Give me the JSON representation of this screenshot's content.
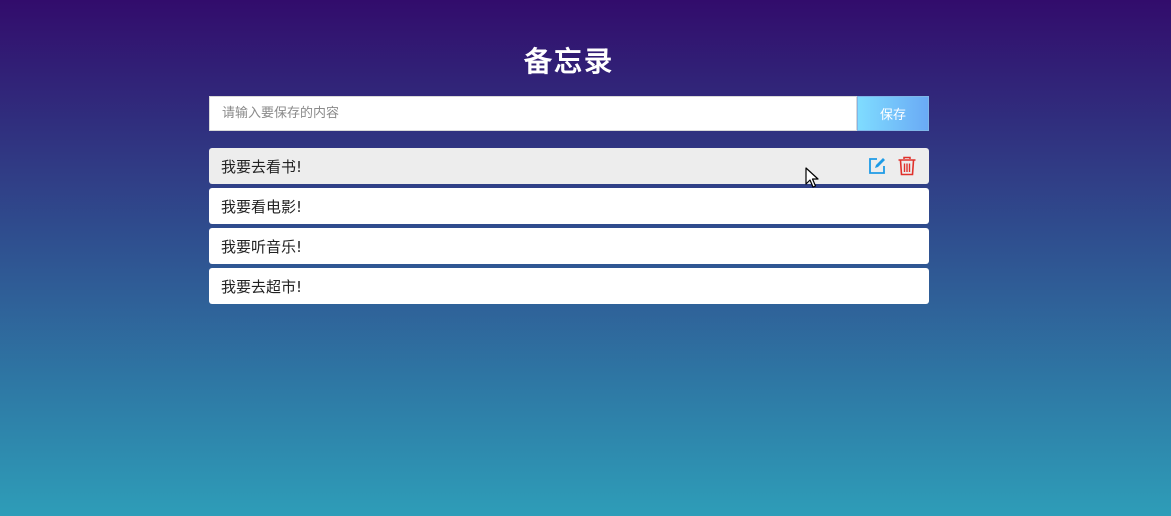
{
  "header": {
    "title": "备忘录"
  },
  "composer": {
    "placeholder": "请输入要保存的内容",
    "value": "",
    "save_label": "保存"
  },
  "memos": [
    {
      "text": "我要去看书!",
      "hovered": true
    },
    {
      "text": "我要看电影!",
      "hovered": false
    },
    {
      "text": "我要听音乐!",
      "hovered": false
    },
    {
      "text": "我要去超市!",
      "hovered": false
    }
  ],
  "item_actions": {
    "edit_icon": "edit-icon",
    "delete_icon": "trash-icon",
    "edit_color": "#1e9be6",
    "delete_color": "#e0312b"
  },
  "colors": {
    "background_top": "#320c6c",
    "background_bottom": "#2e9db8",
    "save_button_start": "#7fdcff",
    "save_button_end": "#6aaaf5",
    "hover_row": "#ededed"
  }
}
